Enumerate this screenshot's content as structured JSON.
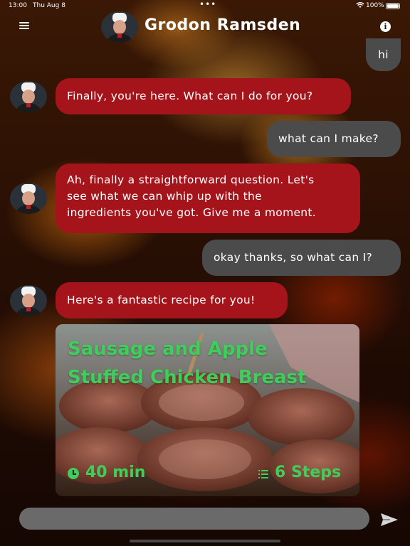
{
  "status_bar": {
    "time": "13:00",
    "date": "Thu Aug 8",
    "battery": "100%"
  },
  "header": {
    "title": "Grodon Ramsden",
    "menu_icon": "hamburger-menu-icon",
    "info_icon": "info-icon"
  },
  "messages": [
    {
      "role": "user",
      "text": "hi"
    },
    {
      "role": "bot",
      "text": "Finally, you're here. What can I do for you?"
    },
    {
      "role": "user",
      "text": "what can I make?"
    },
    {
      "role": "bot",
      "lines": [
        "Ah, finally a straightforward question. Let's",
        "see what we can whip up with the",
        "ingredients you've got. Give me a moment."
      ]
    },
    {
      "role": "user",
      "text": "okay thanks, so what can I?"
    },
    {
      "role": "bot",
      "text": "Here's a fantastic recipe for you!"
    }
  ],
  "recipe": {
    "title_lines": [
      "Sausage and Apple",
      "Stuffed Chicken Breast"
    ],
    "time": "40 min",
    "steps": "6 Steps"
  },
  "composer": {
    "placeholder": "",
    "send_icon": "send-icon"
  },
  "colors": {
    "bot_bubble": "#a5141a",
    "user_bubble": "#4b4b4b",
    "accent_green": "#3ecf5a"
  }
}
